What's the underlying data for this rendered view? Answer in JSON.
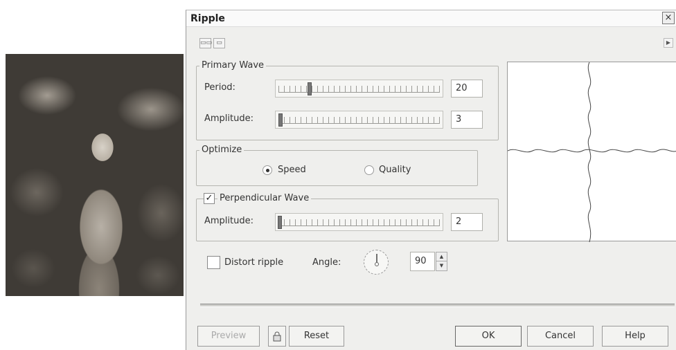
{
  "dialog": {
    "title": "Ripple",
    "close_glyph": "×",
    "toolbar": {
      "icons": [
        "two-pane-view-icon",
        "single-pane-view-icon"
      ],
      "scroll_icon": "scroll-right-icon"
    },
    "primary_wave": {
      "legend": "Primary Wave",
      "period_label": "Period:",
      "period_value": "20",
      "amplitude_label": "Amplitude:",
      "amplitude_value": "3"
    },
    "optimize": {
      "legend": "Optimize",
      "speed_label": "Speed",
      "quality_label": "Quality",
      "selected": "Speed"
    },
    "perpendicular_wave": {
      "legend": "Perpendicular Wave",
      "checked": true,
      "amplitude_label": "Amplitude:",
      "amplitude_value": "2"
    },
    "distort": {
      "label": "Distort ripple",
      "checked": false,
      "angle_label": "Angle:",
      "angle_value": "90"
    },
    "buttons": {
      "preview": "Preview",
      "lock_icon": "lock-icon",
      "reset": "Reset",
      "ok": "OK",
      "cancel": "Cancel",
      "help": "Help"
    }
  }
}
